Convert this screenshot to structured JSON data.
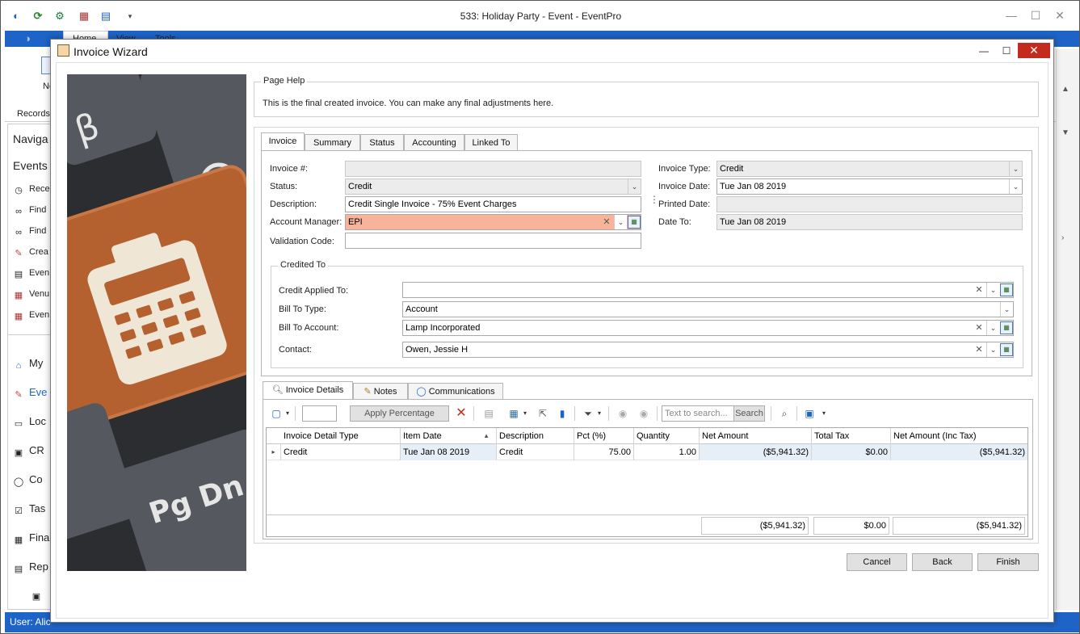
{
  "app": {
    "title": "533: Holiday Party - Event - EventPro",
    "ribbon_tabs": [
      "Home",
      "View",
      "Tools"
    ],
    "ribbon_new_label": "Ne",
    "records_label": "Records",
    "nav_header": "Naviga",
    "events_header": "Events",
    "nav_items": [
      "Rece",
      "Find",
      "Find",
      "Crea",
      "Even",
      "Venu",
      "Even"
    ],
    "nav_sections": [
      "My",
      "Eve",
      "Loc",
      "CR",
      "Co",
      "Tas",
      "Fina",
      "Rep"
    ],
    "status_user": "User: Alic"
  },
  "dialog": {
    "title": "Invoice Wizard",
    "page_help": {
      "label": "Page Help",
      "text": "This is the final created invoice.  You can make any final adjustments here."
    },
    "tabs": [
      "Invoice",
      "Summary",
      "Status",
      "Accounting",
      "Linked To"
    ],
    "form": {
      "invoice_no_label": "Invoice #:",
      "invoice_no_value": "",
      "status_label": "Status:",
      "status_value": "Credit",
      "description_label": "Description:",
      "description_value": "Credit Single Invoice - 75% Event Charges",
      "account_manager_label": "Account Manager:",
      "account_manager_value": "EPI",
      "validation_code_label": "Validation Code:",
      "validation_code_value": "",
      "invoice_type_label": "Invoice Type:",
      "invoice_type_value": "Credit",
      "invoice_date_label": "Invoice Date:",
      "invoice_date_value": "Tue Jan 08 2019",
      "printed_date_label": "Printed Date:",
      "printed_date_value": "",
      "date_to_label": "Date To:",
      "date_to_value": "Tue Jan 08 2019"
    },
    "credited_to": {
      "label": "Credited To",
      "credit_applied_label": "Credit Applied To:",
      "credit_applied_value": "",
      "bill_to_type_label": "Bill To Type:",
      "bill_to_type_value": "Account",
      "bill_to_account_label": "Bill To Account:",
      "bill_to_account_value": "Lamp Incorporated",
      "contact_label": "Contact:",
      "contact_value": "Owen, Jessie H"
    },
    "detail_tabs": [
      "Invoice Details",
      "Notes",
      "Communications"
    ],
    "toolbar": {
      "apply_percentage": "Apply Percentage",
      "search_placeholder": "Text to search...",
      "search_button": "Search"
    },
    "grid": {
      "columns": [
        "Invoice Detail Type",
        "Item Date",
        "Description",
        "Pct (%)",
        "Quantity",
        "Net Amount",
        "Total Tax",
        "Net Amount (Inc Tax)"
      ],
      "rows": [
        {
          "type": "Credit",
          "date": "Tue Jan 08 2019",
          "description": "Credit",
          "pct": "75.00",
          "quantity": "1.00",
          "net": "($5,941.32)",
          "tax": "$0.00",
          "net_inc": "($5,941.32)"
        }
      ],
      "totals": {
        "net": "($5,941.32)",
        "tax": "$0.00",
        "net_inc": "($5,941.32)"
      }
    },
    "buttons": {
      "cancel": "Cancel",
      "back": "Back",
      "finish": "Finish"
    }
  },
  "colors": {
    "accent": "#1e63c6",
    "highlight": "#f7b49a",
    "close": "#c42b1c",
    "key_orange": "#b4612f"
  }
}
